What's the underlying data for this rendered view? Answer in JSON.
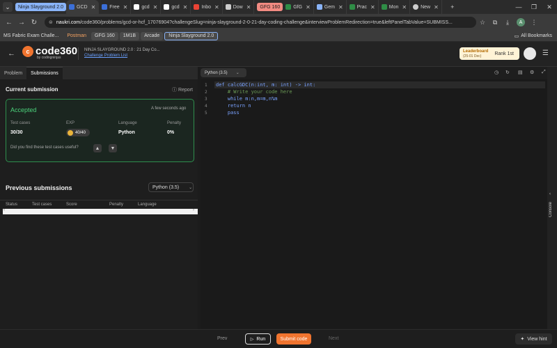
{
  "browser": {
    "tab_groups": [
      {
        "label": "Ninja Slayground 2.0",
        "color": "#8ab4f8",
        "text_color": "#1a1a1a"
      },
      {
        "label": "GFG 160",
        "color": "#f28b82",
        "text_color": "#1a1a1a"
      }
    ],
    "tabs": [
      {
        "label": "GCD",
        "icon": "coding-ninjas-icon",
        "color": "#3b6fd8",
        "active": true
      },
      {
        "label": "Free",
        "icon": "coding-ninjas-icon",
        "color": "#3b6fd8",
        "active": false
      },
      {
        "label": "gcd",
        "icon": "google-icon",
        "color": "#ffffff",
        "active": false
      },
      {
        "label": "gcd",
        "icon": "google-icon",
        "color": "#ffffff",
        "active": false
      },
      {
        "label": "Inbo",
        "icon": "gmail-icon",
        "color": "#ea4335",
        "active": false
      },
      {
        "label": "Dow",
        "icon": "download-icon",
        "color": "#cccccc",
        "active": false
      },
      {
        "label": "GfG",
        "icon": "gfg-icon",
        "color": "#2f8d46",
        "active": false
      },
      {
        "label": "Gem",
        "icon": "gemini-icon",
        "color": "#8ab4f8",
        "active": false
      },
      {
        "label": "Prac",
        "icon": "gfg-icon",
        "color": "#2f8d46",
        "active": false
      },
      {
        "label": "Mon",
        "icon": "gfg-icon",
        "color": "#2f8d46",
        "active": false
      },
      {
        "label": "New",
        "icon": "chrome-icon",
        "color": "#cccccc",
        "active": false
      }
    ],
    "url_host": "naukri.com",
    "url_path": "/code360/problems/gcd-or-hcf_17076904?challengeSlug=ninja-slayground-2-0-21-day-coding-challenge&interviewProblemRedirection=true&leftPanelTabValue=SUBMISS...",
    "profile_initial": "A",
    "bookmarks": [
      {
        "label": "MS Fabric Exam Challe...",
        "badge": false
      },
      {
        "label": "Postman",
        "badge": false
      },
      {
        "label": "GFG 160",
        "badge": true
      },
      {
        "label": "1M1B",
        "badge": false
      },
      {
        "label": "Arcade",
        "badge": false
      },
      {
        "label": "Ninja Slayground 2.0",
        "badge": true
      }
    ],
    "all_bookmarks_label": "All Bookmarks"
  },
  "header": {
    "logo_text": "code360",
    "logo_sub": "by codingninjas",
    "challenge_title": "NINJA SLAYGROUND 2.0 : 21 Day Co...",
    "challenge_link": "Challenge Problem List",
    "leaderboard_title": "Leaderboard",
    "leaderboard_date": "(25-01 Dec)",
    "rank": "Rank 1st"
  },
  "left": {
    "tabs": [
      {
        "label": "Problem",
        "active": false
      },
      {
        "label": "Submissions",
        "active": true
      }
    ],
    "current_submission_title": "Current submission",
    "report_label": "Report",
    "result": {
      "status": "Accepted",
      "time": "A few seconds ago",
      "test_cases_label": "Test cases",
      "test_cases_value": "30/30",
      "exp_label": "EXP",
      "exp_value": "40/40",
      "language_label": "Language",
      "language_value": "Python",
      "penalty_label": "Penalty",
      "penalty_value": "0%",
      "useful_question": "Did you find these test cases useful?"
    },
    "previous_title": "Previous submissions",
    "language_filter": "Python (3.5)",
    "table_headers": [
      "Status",
      "Test cases",
      "Score",
      "Penalty",
      "Language"
    ]
  },
  "editor": {
    "language": "Python (3.5)",
    "lines": [
      {
        "num": "1",
        "text": "def calcGDC(n:int, m: int) -> int:",
        "color": "#7aa2ff"
      },
      {
        "num": "2",
        "text": "    # Write your code here",
        "color": "#6a9955"
      },
      {
        "num": "3",
        "text": "    while m:n,m=m,n%m",
        "color": "#7aa2ff"
      },
      {
        "num": "4",
        "text": "    return n",
        "color": "#7aa2ff"
      },
      {
        "num": "5",
        "text": "    pass",
        "color": "#7aa2ff"
      }
    ],
    "console_label": "Console"
  },
  "footer": {
    "prev": "Prev",
    "run": "Run",
    "submit": "Submit code",
    "next": "Next",
    "hint": "View hint"
  },
  "colors": {
    "accent": "#f0742f",
    "accepted": "#4bd17a",
    "link": "#6aa0ff"
  }
}
